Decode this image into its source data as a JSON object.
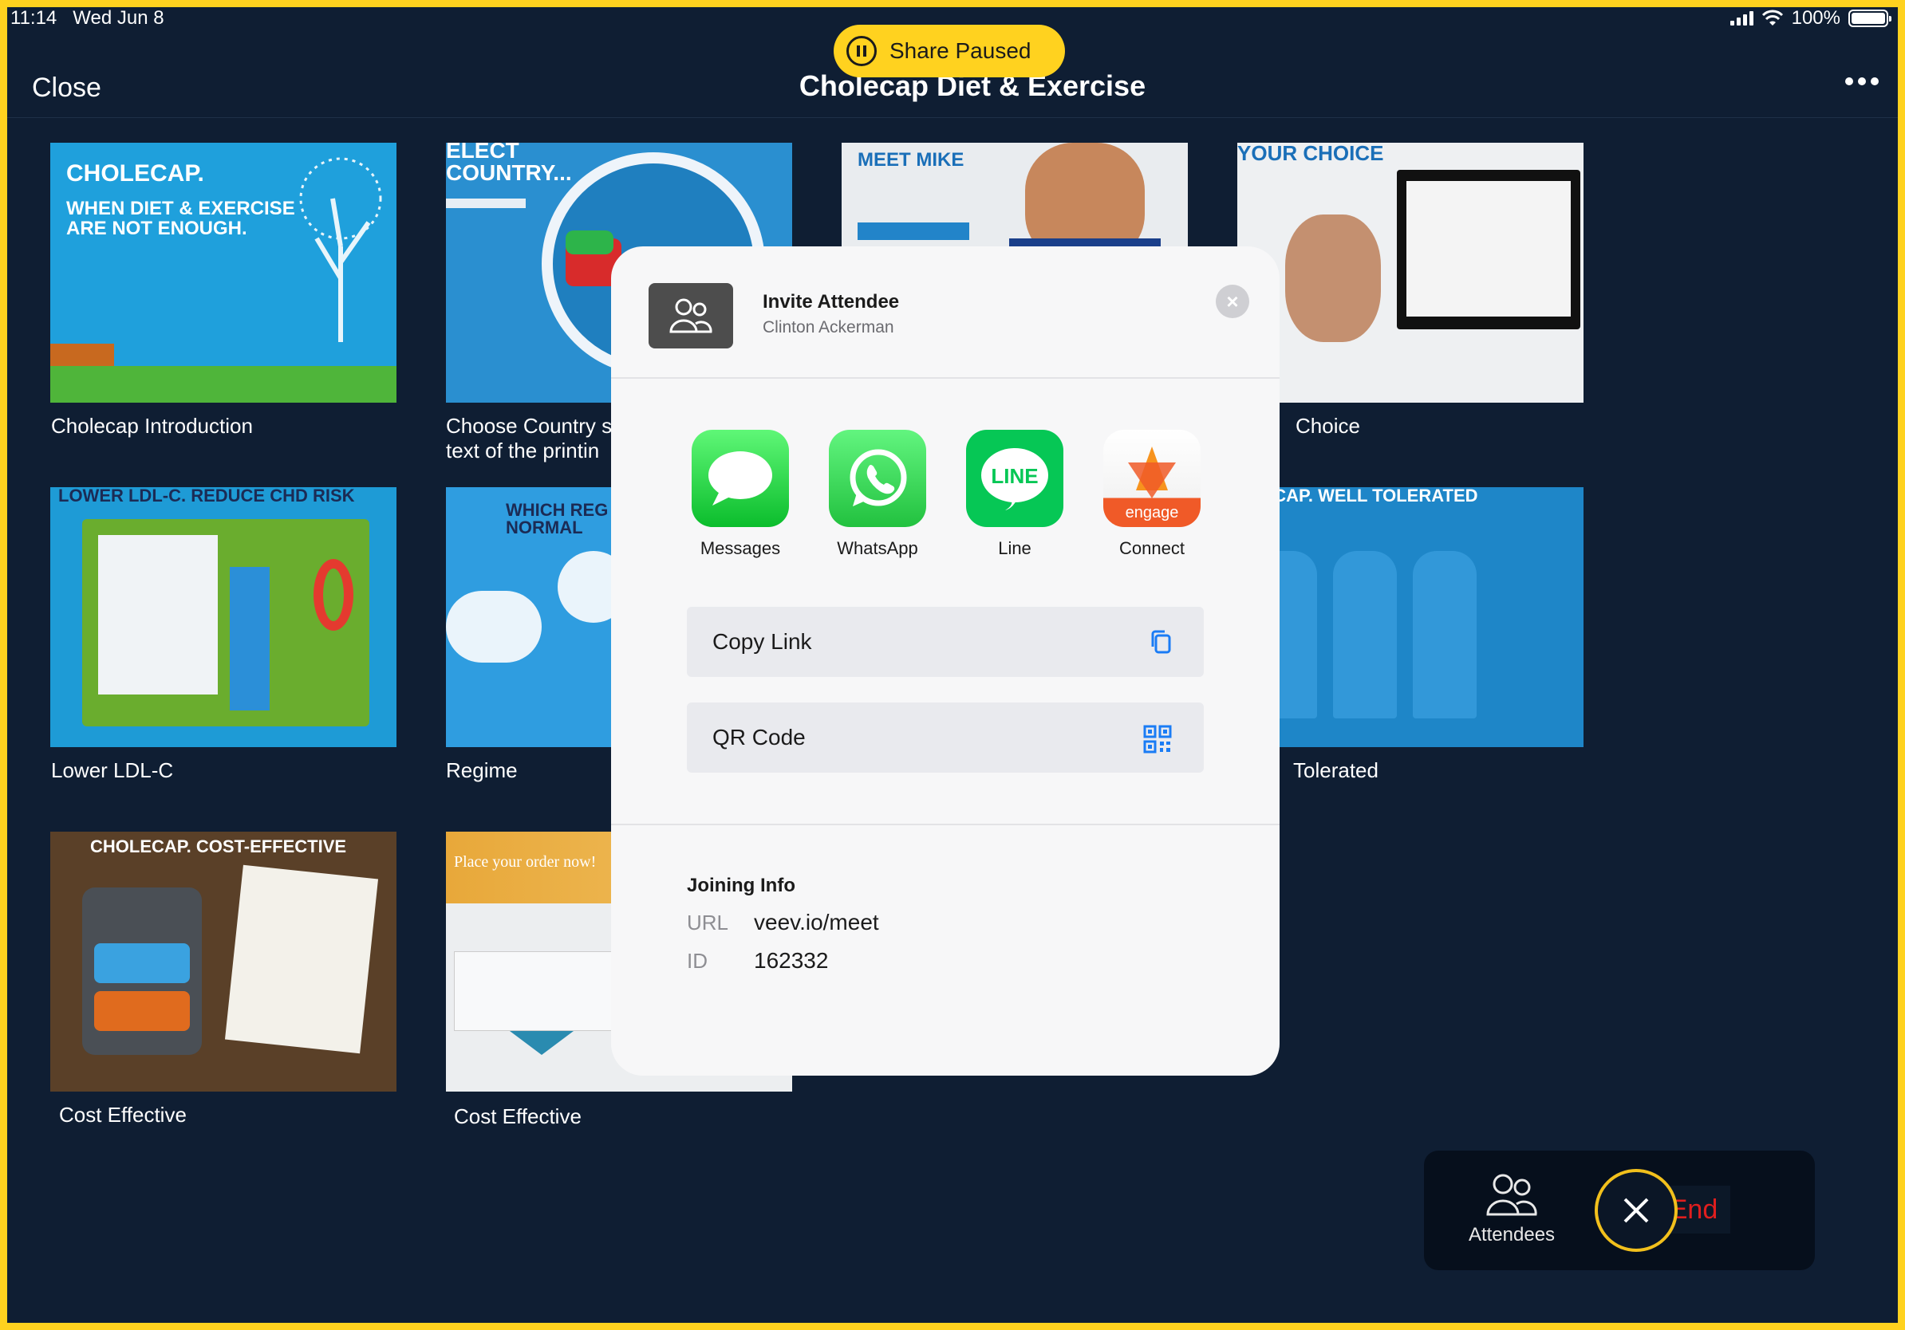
{
  "status": {
    "time": "11:14",
    "date": "Wed Jun 8",
    "battery": "100%"
  },
  "share": {
    "label": "Share Paused"
  },
  "header": {
    "close": "Close",
    "title": "Cholecap Diet & Exercise"
  },
  "slides": [
    {
      "name": "Cholecap Introduction",
      "headline": "CHOLECAP.",
      "sub": "WHEN DIET & EXERCISE ARE NOT ENOUGH."
    },
    {
      "name": "Choose Country s\ntext of the printin",
      "headline": "ELECT COUNTRY..."
    },
    {
      "name": "",
      "headline": "MEET MIKE"
    },
    {
      "name": "Choice",
      "headline": "YOUR CHOICE"
    },
    {
      "name": "Lower LDL-C",
      "headline": "LOWER LDL-C. REDUCE CHD RISK"
    },
    {
      "name": "Regime",
      "headline": "WHICH REG YOU NORMAL"
    },
    {
      "name": "Tolerated",
      "headline": "OLECAP. WELL TOLERATED"
    },
    {
      "name": "Cost Effective",
      "headline": "CHOLECAP. COST-EFFECTIVE"
    },
    {
      "name": "Cost Effective",
      "headline": "Place your order now!"
    }
  ],
  "modal": {
    "title": "Invite Attendee",
    "subtitle": "Clinton Ackerman",
    "apps": [
      {
        "label": "Messages",
        "icon": "messages-icon"
      },
      {
        "label": "WhatsApp",
        "icon": "whatsapp-icon"
      },
      {
        "label": "Line",
        "icon": "line-icon",
        "glyph": "LINE"
      },
      {
        "label": "Connect",
        "icon": "engage-connect-icon",
        "glyph": "engage"
      }
    ],
    "copy_link": "Copy Link",
    "qr_code": "QR Code",
    "joining_title": "Joining Info",
    "url_key": "URL",
    "url_value": "veev.io/meet",
    "id_key": "ID",
    "id_value": "162332"
  },
  "dock": {
    "attendees": "Attendees",
    "end": "End"
  },
  "colors": {
    "accent": "#ffd21f",
    "background": "#0f1e33",
    "end": "#e01e1e",
    "link_blue": "#1a7cf5"
  }
}
